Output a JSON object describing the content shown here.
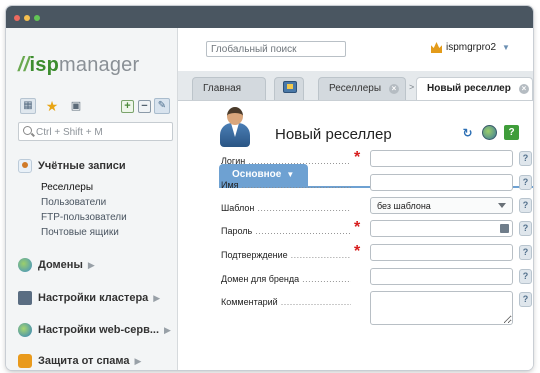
{
  "colors": {
    "brand_green": "#3c8d2f",
    "accent_blue": "#6ea1d2",
    "required_red": "#d71d1d",
    "titlebar": "#4a5661"
  },
  "logo": {
    "prefix": "//",
    "brand_a": "isp",
    "brand_b": "manager"
  },
  "sidebar": {
    "toolbar_icons": [
      "grid-icon",
      "star-icon",
      "briefcase-icon",
      "expand-all-icon",
      "collapse-all-icon",
      "pin-icon"
    ],
    "search_placeholder": "Ctrl + Shift + M",
    "sections": [
      {
        "label": "Учётные записи",
        "icon": "users-icon",
        "expanded": true,
        "items": [
          "Реселлеры",
          "Пользователи",
          "FTP-пользователи",
          "Почтовые ящики"
        ]
      },
      {
        "label": "Домены",
        "icon": "globe-icon"
      },
      {
        "label": "Настройки кластера",
        "icon": "cluster-icon"
      },
      {
        "label": "Настройки web-серв...",
        "icon": "web-globe-icon"
      },
      {
        "label": "Защита от спама",
        "icon": "shield-icon"
      }
    ]
  },
  "header": {
    "search_placeholder": "Глобальный поиск",
    "user_name": "ispmgrpro2"
  },
  "tabs": [
    {
      "label": "Главная"
    },
    {
      "label": "",
      "icon": "monitor-icon"
    },
    {
      "label": "Реселлеры",
      "closable": true
    },
    {
      "label": "Новый реселлер",
      "closable": true,
      "active": true
    }
  ],
  "tab_separator": ">",
  "page": {
    "title": "Новый реселлер",
    "form_tab": "Основное",
    "fields": [
      {
        "label": "Логин",
        "required": true,
        "value": ""
      },
      {
        "label": "Имя",
        "required": false,
        "value": ""
      },
      {
        "label": "Шаблон",
        "required": false,
        "value": "без шаблона"
      },
      {
        "label": "Пароль",
        "required": true,
        "value": ""
      },
      {
        "label": "Подтверждение",
        "required": true,
        "value": ""
      },
      {
        "label": "Домен для бренда",
        "required": false,
        "value": ""
      },
      {
        "label": "Комментарий",
        "required": false,
        "value": ""
      }
    ],
    "hint_label": "?",
    "required_mark": "*"
  }
}
